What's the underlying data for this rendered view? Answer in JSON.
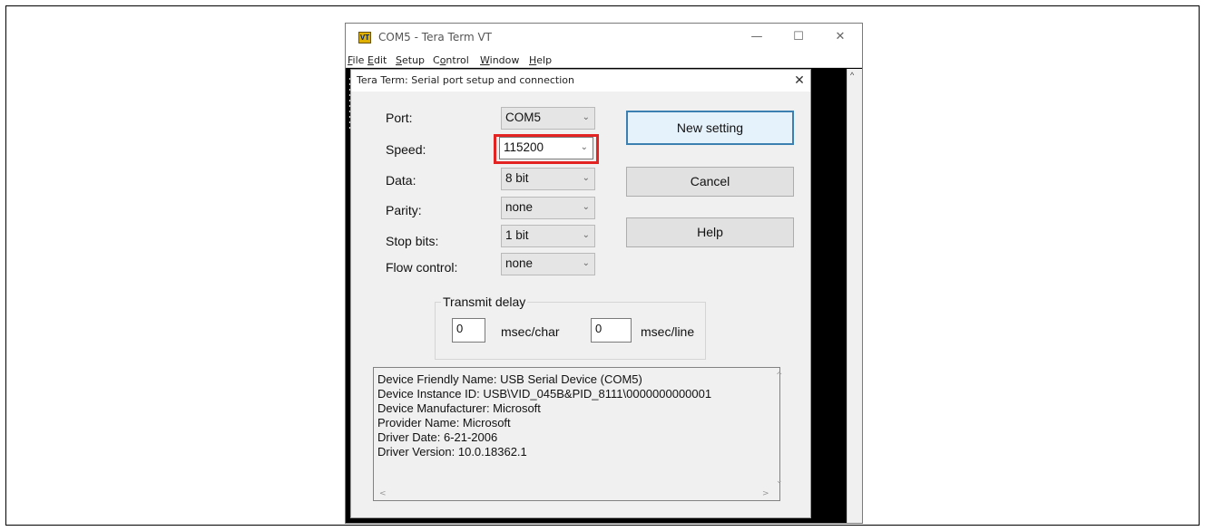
{
  "main_window": {
    "app_icon": "VT",
    "title": "COM5 - Tera Term VT",
    "controls": {
      "minimize": "—",
      "maximize": "☐",
      "close": "✕"
    },
    "menu": [
      {
        "label": "File",
        "accel": "F",
        "rest": "ile"
      },
      {
        "label": "Edit",
        "accel": "E",
        "rest": "dit"
      },
      {
        "label": "Setup",
        "accel": "S",
        "rest": "etup"
      },
      {
        "label": "Control",
        "pre": "C",
        "accel": "o",
        "rest": "ntrol"
      },
      {
        "label": "Window",
        "accel": "W",
        "rest": "indow"
      },
      {
        "label": "Help",
        "accel": "H",
        "rest": "elp"
      }
    ]
  },
  "dialog": {
    "title": "Tera Term: Serial port setup and connection",
    "close": "✕",
    "fields": {
      "port": {
        "label": "Port:",
        "value": "COM5"
      },
      "speed": {
        "label": "Speed:",
        "value": "115200"
      },
      "data": {
        "label": "Data:",
        "value": "8 bit"
      },
      "parity": {
        "label": "Parity:",
        "value": "none"
      },
      "stop_bits": {
        "label": "Stop bits:",
        "value": "1 bit"
      },
      "flow_control": {
        "label": "Flow control:",
        "value": "none"
      }
    },
    "buttons": {
      "new_setting": "New setting",
      "cancel": "Cancel",
      "help": "Help"
    },
    "transmit_delay": {
      "legend": "Transmit delay",
      "char_value": "0",
      "char_unit": "msec/char",
      "line_value": "0",
      "line_unit": "msec/line"
    },
    "device_info": [
      "Device Friendly Name: USB Serial Device (COM5)",
      "Device Instance ID: USB\\VID_045B&PID_8111\\0000000000001",
      "Device Manufacturer: Microsoft",
      "Provider Name: Microsoft",
      "Driver Date: 6-21-2006",
      "Driver Version: 10.0.18362.1"
    ],
    "highlight_color": "#e32222"
  }
}
